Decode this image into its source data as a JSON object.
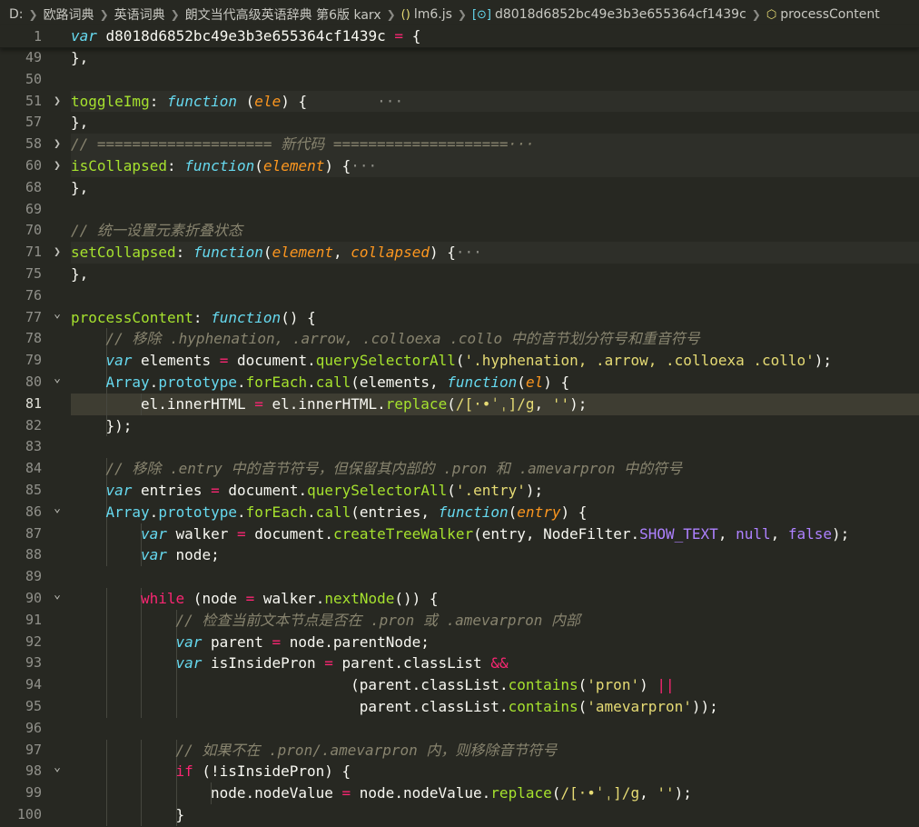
{
  "breadcrumb": [
    {
      "label": "D:",
      "icon": ""
    },
    {
      "label": "欧路词典",
      "icon": ""
    },
    {
      "label": "英语词典",
      "icon": ""
    },
    {
      "label": "朗文当代高级英语辞典 第6版 karx",
      "icon": ""
    },
    {
      "label": "lm6.js",
      "icon": "js-file-icon",
      "glyph": "(⁠)"
    },
    {
      "label": "d8018d6852bc49e3b3e655364cf1439c",
      "icon": "variable-icon",
      "glyph": "[⊙]"
    },
    {
      "label": "processContent",
      "icon": "method-icon",
      "glyph": "⬡"
    }
  ],
  "lines": [
    {
      "n": "1",
      "fold": "",
      "indent": 0,
      "tokens": [
        [
          "kw",
          "var"
        ],
        [
          "ident",
          " d8018d6852bc49e3b3e655364cf1439c "
        ],
        [
          "op",
          "="
        ],
        [
          "pun",
          " {"
        ]
      ],
      "sticky": true
    },
    {
      "n": "49",
      "fold": "",
      "indent": 1,
      "tokens": [
        [
          "pun",
          "},"
        ]
      ]
    },
    {
      "n": "50",
      "fold": "",
      "indent": 0,
      "tokens": []
    },
    {
      "n": "51",
      "fold": ">",
      "indent": 1,
      "tokens": [
        [
          "prop",
          "toggleImg"
        ],
        [
          "pun",
          ": "
        ],
        [
          "kw",
          "function"
        ],
        [
          "pun",
          " ("
        ],
        [
          "param",
          "ele"
        ],
        [
          "pun",
          ") {"
        ],
        [
          "fold-ellipsis",
          "        ···"
        ]
      ],
      "band": true
    },
    {
      "n": "57",
      "fold": "",
      "indent": 1,
      "tokens": [
        [
          "pun",
          "},"
        ]
      ]
    },
    {
      "n": "58",
      "fold": ">",
      "indent": 1,
      "tokens": [
        [
          "com",
          "// ==================== 新代码 ====================···"
        ]
      ],
      "band": true
    },
    {
      "n": "60",
      "fold": ">",
      "indent": 1,
      "tokens": [
        [
          "prop",
          "isCollapsed"
        ],
        [
          "pun",
          ": "
        ],
        [
          "kw",
          "function"
        ],
        [
          "pun",
          "("
        ],
        [
          "param",
          "element"
        ],
        [
          "pun",
          ") {"
        ],
        [
          "fold-ellipsis",
          "···"
        ]
      ],
      "band": true
    },
    {
      "n": "68",
      "fold": "",
      "indent": 1,
      "tokens": [
        [
          "pun",
          "},"
        ]
      ]
    },
    {
      "n": "69",
      "fold": "",
      "indent": 0,
      "tokens": []
    },
    {
      "n": "70",
      "fold": "",
      "indent": 1,
      "tokens": [
        [
          "com",
          "// 统一设置元素折叠状态"
        ]
      ]
    },
    {
      "n": "71",
      "fold": ">",
      "indent": 1,
      "tokens": [
        [
          "prop",
          "setCollapsed"
        ],
        [
          "pun",
          ": "
        ],
        [
          "kw",
          "function"
        ],
        [
          "pun",
          "("
        ],
        [
          "param",
          "element"
        ],
        [
          "pun",
          ", "
        ],
        [
          "param",
          "collapsed"
        ],
        [
          "pun",
          ") {"
        ],
        [
          "fold-ellipsis",
          "···"
        ]
      ],
      "band": true
    },
    {
      "n": "75",
      "fold": "",
      "indent": 1,
      "tokens": [
        [
          "pun",
          "},"
        ]
      ]
    },
    {
      "n": "76",
      "fold": "",
      "indent": 0,
      "tokens": []
    },
    {
      "n": "77",
      "fold": "v",
      "indent": 1,
      "tokens": [
        [
          "prop",
          "processContent"
        ],
        [
          "pun",
          ": "
        ],
        [
          "kw",
          "function"
        ],
        [
          "pun",
          "() {"
        ]
      ]
    },
    {
      "n": "78",
      "fold": "",
      "indent": 2,
      "tokens": [
        [
          "com",
          "// 移除 .hyphenation, .arrow, .colloexa .collo 中的音节划分符号和重音符号"
        ]
      ]
    },
    {
      "n": "79",
      "fold": "",
      "indent": 2,
      "tokens": [
        [
          "kw",
          "var"
        ],
        [
          "ident",
          " elements "
        ],
        [
          "op",
          "="
        ],
        [
          "ident",
          " document"
        ],
        [
          "pun",
          "."
        ],
        [
          "fn",
          "querySelectorAll"
        ],
        [
          "pun",
          "("
        ],
        [
          "str",
          "'.hyphenation, .arrow, .colloexa .collo'"
        ],
        [
          "pun",
          ");"
        ]
      ]
    },
    {
      "n": "80",
      "fold": "v",
      "indent": 2,
      "tokens": [
        [
          "cls",
          "Array"
        ],
        [
          "pun",
          "."
        ],
        [
          "cls",
          "prototype"
        ],
        [
          "pun",
          "."
        ],
        [
          "fn",
          "forEach"
        ],
        [
          "pun",
          "."
        ],
        [
          "fn",
          "call"
        ],
        [
          "pun",
          "(elements, "
        ],
        [
          "kw",
          "function"
        ],
        [
          "pun",
          "("
        ],
        [
          "param",
          "el"
        ],
        [
          "pun",
          ") {"
        ]
      ]
    },
    {
      "n": "81",
      "fold": "",
      "indent": 3,
      "tokens": [
        [
          "ident",
          "el"
        ],
        [
          "pun",
          "."
        ],
        [
          "ident",
          "innerHTML "
        ],
        [
          "op",
          "="
        ],
        [
          "ident",
          " el"
        ],
        [
          "pun",
          "."
        ],
        [
          "ident",
          "innerHTML"
        ],
        [
          "pun",
          "."
        ],
        [
          "fn",
          "replace"
        ],
        [
          "pun",
          "("
        ],
        [
          "str",
          "/[·•ˈˌ]/g"
        ],
        [
          "pun",
          ", "
        ],
        [
          "str",
          "''"
        ],
        [
          "pun",
          ");"
        ]
      ],
      "active": true
    },
    {
      "n": "82",
      "fold": "",
      "indent": 2,
      "tokens": [
        [
          "pun",
          "});"
        ]
      ]
    },
    {
      "n": "83",
      "fold": "",
      "indent": 0,
      "tokens": []
    },
    {
      "n": "84",
      "fold": "",
      "indent": 2,
      "tokens": [
        [
          "com",
          "// 移除 .entry 中的音节符号，但保留其内部的 .pron 和 .amevarpron 中的符号"
        ]
      ]
    },
    {
      "n": "85",
      "fold": "",
      "indent": 2,
      "tokens": [
        [
          "kw",
          "var"
        ],
        [
          "ident",
          " entries "
        ],
        [
          "op",
          "="
        ],
        [
          "ident",
          " document"
        ],
        [
          "pun",
          "."
        ],
        [
          "fn",
          "querySelectorAll"
        ],
        [
          "pun",
          "("
        ],
        [
          "str",
          "'.entry'"
        ],
        [
          "pun",
          ");"
        ]
      ]
    },
    {
      "n": "86",
      "fold": "v",
      "indent": 2,
      "tokens": [
        [
          "cls",
          "Array"
        ],
        [
          "pun",
          "."
        ],
        [
          "cls",
          "prototype"
        ],
        [
          "pun",
          "."
        ],
        [
          "fn",
          "forEach"
        ],
        [
          "pun",
          "."
        ],
        [
          "fn",
          "call"
        ],
        [
          "pun",
          "(entries, "
        ],
        [
          "kw",
          "function"
        ],
        [
          "pun",
          "("
        ],
        [
          "param",
          "entry"
        ],
        [
          "pun",
          ") {"
        ]
      ]
    },
    {
      "n": "87",
      "fold": "",
      "indent": 3,
      "tokens": [
        [
          "kw",
          "var"
        ],
        [
          "ident",
          " walker "
        ],
        [
          "op",
          "="
        ],
        [
          "ident",
          " document"
        ],
        [
          "pun",
          "."
        ],
        [
          "fn",
          "createTreeWalker"
        ],
        [
          "pun",
          "(entry, NodeFilter."
        ],
        [
          "num",
          "SHOW_TEXT"
        ],
        [
          "pun",
          ", "
        ],
        [
          "num",
          "null"
        ],
        [
          "pun",
          ", "
        ],
        [
          "num",
          "false"
        ],
        [
          "pun",
          ");"
        ]
      ]
    },
    {
      "n": "88",
      "fold": "",
      "indent": 3,
      "tokens": [
        [
          "kw",
          "var"
        ],
        [
          "ident",
          " node;"
        ]
      ]
    },
    {
      "n": "89",
      "fold": "",
      "indent": 0,
      "tokens": []
    },
    {
      "n": "90",
      "fold": "v",
      "indent": 3,
      "tokens": [
        [
          "kw2",
          "while"
        ],
        [
          "pun",
          " (node "
        ],
        [
          "op",
          "="
        ],
        [
          "ident",
          " walker"
        ],
        [
          "pun",
          "."
        ],
        [
          "fn",
          "nextNode"
        ],
        [
          "pun",
          "()) {"
        ]
      ]
    },
    {
      "n": "91",
      "fold": "",
      "indent": 4,
      "tokens": [
        [
          "com",
          "// 检查当前文本节点是否在 .pron 或 .amevarpron 内部"
        ]
      ]
    },
    {
      "n": "92",
      "fold": "",
      "indent": 4,
      "tokens": [
        [
          "kw",
          "var"
        ],
        [
          "ident",
          " parent "
        ],
        [
          "op",
          "="
        ],
        [
          "ident",
          " node"
        ],
        [
          "pun",
          "."
        ],
        [
          "ident",
          "parentNode;"
        ]
      ]
    },
    {
      "n": "93",
      "fold": "",
      "indent": 4,
      "tokens": [
        [
          "kw",
          "var"
        ],
        [
          "ident",
          " isInsidePron "
        ],
        [
          "op",
          "="
        ],
        [
          "ident",
          " parent"
        ],
        [
          "pun",
          "."
        ],
        [
          "ident",
          "classList "
        ],
        [
          "op",
          "&&"
        ]
      ]
    },
    {
      "n": "94",
      "fold": "",
      "indent": 4,
      "extra": "                    ",
      "tokens": [
        [
          "pun",
          "                    (parent"
        ],
        [
          "pun",
          "."
        ],
        [
          "ident",
          "classList"
        ],
        [
          "pun",
          "."
        ],
        [
          "fn",
          "contains"
        ],
        [
          "pun",
          "("
        ],
        [
          "str",
          "'pron'"
        ],
        [
          "pun",
          ") "
        ],
        [
          "op",
          "||"
        ]
      ]
    },
    {
      "n": "95",
      "fold": "",
      "indent": 4,
      "tokens": [
        [
          "pun",
          "                     parent"
        ],
        [
          "pun",
          "."
        ],
        [
          "ident",
          "classList"
        ],
        [
          "pun",
          "."
        ],
        [
          "fn",
          "contains"
        ],
        [
          "pun",
          "("
        ],
        [
          "str",
          "'amevarpron'"
        ],
        [
          "pun",
          "));"
        ]
      ]
    },
    {
      "n": "96",
      "fold": "",
      "indent": 0,
      "tokens": []
    },
    {
      "n": "97",
      "fold": "",
      "indent": 4,
      "tokens": [
        [
          "com",
          "// 如果不在 .pron/.amevarpron 内，则移除音节符号"
        ]
      ]
    },
    {
      "n": "98",
      "fold": "v",
      "indent": 4,
      "tokens": [
        [
          "kw2",
          "if"
        ],
        [
          "pun",
          " (!isInsidePron) {"
        ]
      ]
    },
    {
      "n": "99",
      "fold": "",
      "indent": 5,
      "tokens": [
        [
          "ident",
          "node"
        ],
        [
          "pun",
          "."
        ],
        [
          "ident",
          "nodeValue "
        ],
        [
          "op",
          "="
        ],
        [
          "ident",
          " node"
        ],
        [
          "pun",
          "."
        ],
        [
          "ident",
          "nodeValue"
        ],
        [
          "pun",
          "."
        ],
        [
          "fn",
          "replace"
        ],
        [
          "pun",
          "("
        ],
        [
          "str",
          "/[·•ˈˌ]/g"
        ],
        [
          "pun",
          ", "
        ],
        [
          "str",
          "''"
        ],
        [
          "pun",
          ");"
        ]
      ]
    },
    {
      "n": "100",
      "fold": "",
      "indent": 4,
      "tokens": [
        [
          "pun",
          "}"
        ]
      ]
    }
  ]
}
